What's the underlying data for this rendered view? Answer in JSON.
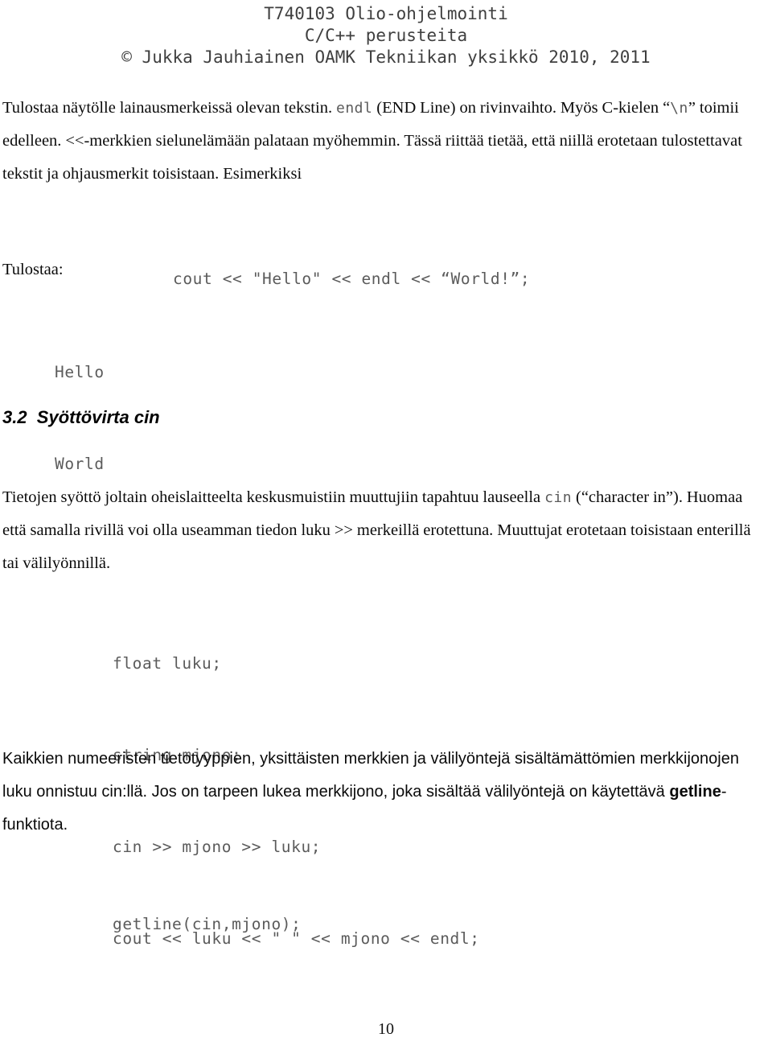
{
  "header": {
    "line1": "T740103 Olio-ohjelmointi",
    "line2": "C/C++ perusteita",
    "line3": "© Jukka Jauhiainen OAMK Tekniikan yksikkö 2010, 2011"
  },
  "paragraph1": {
    "part1": "Tulostaa näytölle lainausmerkeissä olevan tekstin. ",
    "code1": "endl",
    "part2": "  (END Line) on rivinvaihto. Myös C-kielen “",
    "code2": "\\n",
    "part3": "” toimii edelleen. <<-merkkien sielunelämään palataan myöhemmin. Tässä riittää tietää, että niillä erotetaan tulostettavat tekstit ja ohjausmerkit toisistaan. Esimerkiksi"
  },
  "code_block_1": {
    "line1": "cout << \"Hello\" << endl << “World!”;"
  },
  "tulostaa_label": "Tulostaa:",
  "output_block": {
    "line1": "Hello",
    "line2": "World"
  },
  "section_heading": {
    "number": "3.2",
    "title": "Syöttövirta cin",
    "full": "3.2  Syöttövirta cin"
  },
  "paragraph2": {
    "part1": "Tietojen syöttö joltain oheislaitteelta keskusmuistiin muuttujiin  tapahtuu lauseella ",
    "code1": "cin",
    "part2": " (“character in”). Huomaa että samalla rivillä voi olla useamman tiedon luku >> merkeillä erotettuna. Muuttujat erotetaan toisistaan enterillä tai välilyönnillä."
  },
  "code_block_2": {
    "line1": "float luku;",
    "line2": "string mjono;",
    "line3": "cin >> mjono >> luku;",
    "line4": "cout << luku << \" \" << mjono << endl;"
  },
  "paragraph3": {
    "part1": "Kaikkien numeeristen tietotyyppien, yksittäisten merkkien ja välilyöntejä sisältämättömien merkkijonojen luku onnistuu cin:llä. Jos on tarpeen lukea merkkijono, joka sisältää välilyöntejä on käytettävä ",
    "bold1": "getline",
    "part2": "-funktiota."
  },
  "code_block_3": {
    "line1": "getline(cin,mjono);"
  },
  "page_number": "10"
}
